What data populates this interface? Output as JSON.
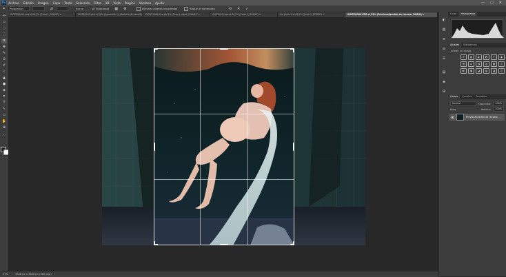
{
  "app": {
    "logo": "Ps",
    "menu": [
      "Archivo",
      "Edición",
      "Imagen",
      "Capa",
      "Texto",
      "Selección",
      "Filtro",
      "3D",
      "Vista",
      "Plugins",
      "Ventana",
      "Ayuda"
    ],
    "window_controls": [
      "—",
      "▢",
      "✕"
    ]
  },
  "options_bar": {
    "ratio": "Proporción",
    "ratio_value_1": "",
    "ratio_value_2": "",
    "clear": "Borrar",
    "straighten": "Enderezar",
    "delete_cropped": "Eliminar píxeles recortados",
    "content_aware": "Según el contenido",
    "icons": [
      "⟲",
      "✕",
      "✓"
    ]
  },
  "tabs": [
    {
      "label": "IDOPEG0091.psd al 66,7% (Capa 1, RGB/8*) ×",
      "active": false
    },
    {
      "label": "IDOPEG023.psd al 50% (Exposición 1, Máscara de capa/8) ×",
      "active": false
    },
    {
      "label": "IDO0G1086.tif al 66,7% (Capa 1 copia, RGB/8*) ×",
      "active": false
    },
    {
      "label": "IDOPEG09.psd al 66,7% (Capa 1, RGB/8*) ×",
      "active": false
    },
    {
      "label": "Sin título-1 al 66,7% (Capa 1, RGB/8*) ×",
      "active": false
    },
    {
      "label": "IDOPEG009.EPR al 33% (Previsualización de recorte, RGB/8) ×",
      "active": true
    }
  ],
  "tools": [
    "↔",
    "▭",
    "◌",
    "⬚",
    "⌗",
    "✥",
    "✎",
    "⊙",
    "✐",
    "⌇",
    "▲",
    "●",
    "◈",
    "✒",
    "T",
    "↖",
    "▭",
    "✋",
    "⊕",
    "⋯"
  ],
  "status": {
    "zoom": "33%",
    "doc_size": "3648 px x 3648 px (300 ppp)",
    "arrow": "›"
  },
  "right_panel": {
    "top_tabs": [
      "Color",
      "Histograma"
    ],
    "adjust_tabs": [
      "Ajustes",
      "Bibliotecas"
    ],
    "adjust_label": "Añadir un ajuste",
    "adj_icons": [
      "☀",
      "▥",
      "◐",
      "◩",
      "▽",
      "◆",
      "▤",
      "⚖",
      "◑",
      "◍",
      "▦",
      "◫",
      "◧",
      "▣",
      "◢",
      "▨",
      "◪",
      "◰"
    ],
    "layer_tabs": [
      "Capas",
      "Canales",
      "Trazados"
    ],
    "blend_mode": "Normal",
    "opacity_label": "Opacidad:",
    "opacity_value": "100%",
    "lock_label": "Bloq:",
    "fill_label": "Relleno:",
    "fill_value": "100%",
    "layer_name": "Previsualización de recorte",
    "eye": "👁"
  },
  "strip_icons": [
    "◐",
    "▧",
    "≡",
    "◎",
    "☰",
    "▤",
    "◈",
    "⊞"
  ]
}
